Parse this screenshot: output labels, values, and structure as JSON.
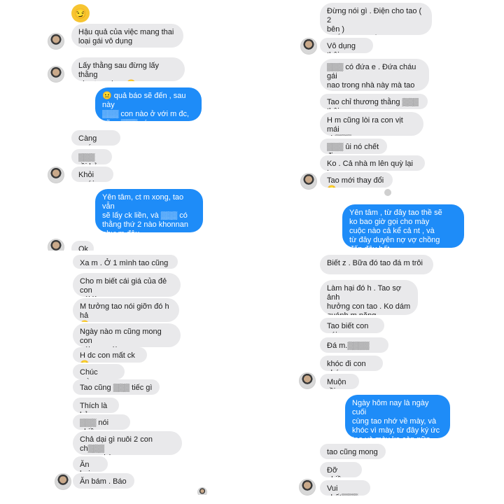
{
  "panel_tl": {
    "header_emoji": "😏",
    "messages": [
      {
        "side": "in",
        "text": "Hậu quả của việc mang thai\nloại gái vô dụng"
      },
      {
        "side": "in",
        "text": "Lấy thằng sau đừng lấy thằng\nnhư tao nhen 😏"
      },
      {
        "side": "out",
        "text": "😐 quả báo sẽ đến , sau này\n▒▒▒ con nào ở với m đc,\ncũng ▒▒▒ có con."
      },
      {
        "side": "in",
        "text": "Càng sướng"
      },
      {
        "side": "in",
        "text": "▒▒▒ rồi bỏ"
      },
      {
        "side": "in",
        "text": "Khỏi cưới"
      },
      {
        "side": "out",
        "text": "Yên tâm, ct m xong, tao vẫn\nsẽ lấy ck liền, và ▒▒▒ có\nthằng thứ 2 nào khonnan\nnhư m đâu"
      },
      {
        "side": "in",
        "text": "Ok"
      }
    ]
  },
  "panel_tr": {
    "messages": [
      {
        "side": "in",
        "text": "Đừng nói gì . Điện cho tao ( 2\nbên )\nNhắn tin thuyết phục"
      },
      {
        "side": "in",
        "text": "Vô dụng thôi"
      },
      {
        "side": "in",
        "text": "▒▒▒ có đứa e . Đứa cháu gái\nnao trong nhà này mà tao\nthương"
      },
      {
        "side": "in",
        "text": "Tao chỉ thương thằng ▒▒▒ thôi"
      },
      {
        "side": "in",
        "text": "H m cũng lòi ra con vịt mái\nch▒▒▒"
      },
      {
        "side": "in",
        "text": "▒▒▒ ûi nó chết đi"
      },
      {
        "side": "in",
        "text": "Ko . Cả nhà m lên quỳ lại tao"
      },
      {
        "side": "in",
        "text": "Tao mới thay đổi 😏"
      },
      {
        "side": "out",
        "text": "Yên tâm , từ đây tao thề sẽ\nko bao giờ gọi cho mày\ncuộc nào cả kể cả nt , và\ntừ đây duyên nợ vợ chồng\nđến đây hết ."
      }
    ]
  },
  "panel_bl": {
    "messages": [
      {
        "side": "in",
        "text": "Xa m . Ở 1 mình tao cũng hp"
      },
      {
        "side": "in",
        "text": "Cho m biết cái giá của đẻ con\ngái là z"
      },
      {
        "side": "in",
        "text": "M tưởng tao nói giỡn đó h hả\n😏"
      },
      {
        "side": "in",
        "text": "Ngày nào m cũng mong con\ngái con gái"
      },
      {
        "side": "in",
        "text": "H dc con mất ck 😏"
      },
      {
        "side": "in",
        "text": "Chúc mừng"
      },
      {
        "side": "in",
        "text": "Tao cũng ▒▒▒ tiếc gì m"
      },
      {
        "side": "in",
        "text": "Thích là bỏ"
      },
      {
        "side": "in",
        "text": "▒▒▒ nói nhiều"
      },
      {
        "side": "in",
        "text": "Chả dại gì nuôi 2 con ch▒▒▒\ntrong nhà"
      },
      {
        "side": "in",
        "text": "Ăn hại"
      },
      {
        "side": "in",
        "text": "Ăn bám . Báo ."
      }
    ]
  },
  "panel_br": {
    "messages": [
      {
        "side": "in",
        "text": "Biết z . Bữa đó tao đá m trôi"
      },
      {
        "side": "in",
        "text": "Làm hại đó h . Tao sợ ảnh\nhưởng con tao . Ko dám\nquánh m nặng"
      },
      {
        "side": "in",
        "text": "Tao biết con gái"
      },
      {
        "side": "in",
        "text": "Đá m.▒▒▒▒"
      },
      {
        "side": "in",
        "text": "khóc đi con chó"
      },
      {
        "side": "in",
        "text": "Muộn rồi"
      },
      {
        "side": "out",
        "text": "Ngày hôm nay là ngày cuối\ncùng tao nhớ về mày, và\nkhóc vì mày, từ đây ký ức\ntao và mày ko còn nữa"
      },
      {
        "side": "in",
        "text": "tao cũng mong z"
      },
      {
        "side": "in",
        "text": "Đỡ phiền"
      },
      {
        "side": "in",
        "text": "Vui chết▒▒▒"
      }
    ]
  }
}
